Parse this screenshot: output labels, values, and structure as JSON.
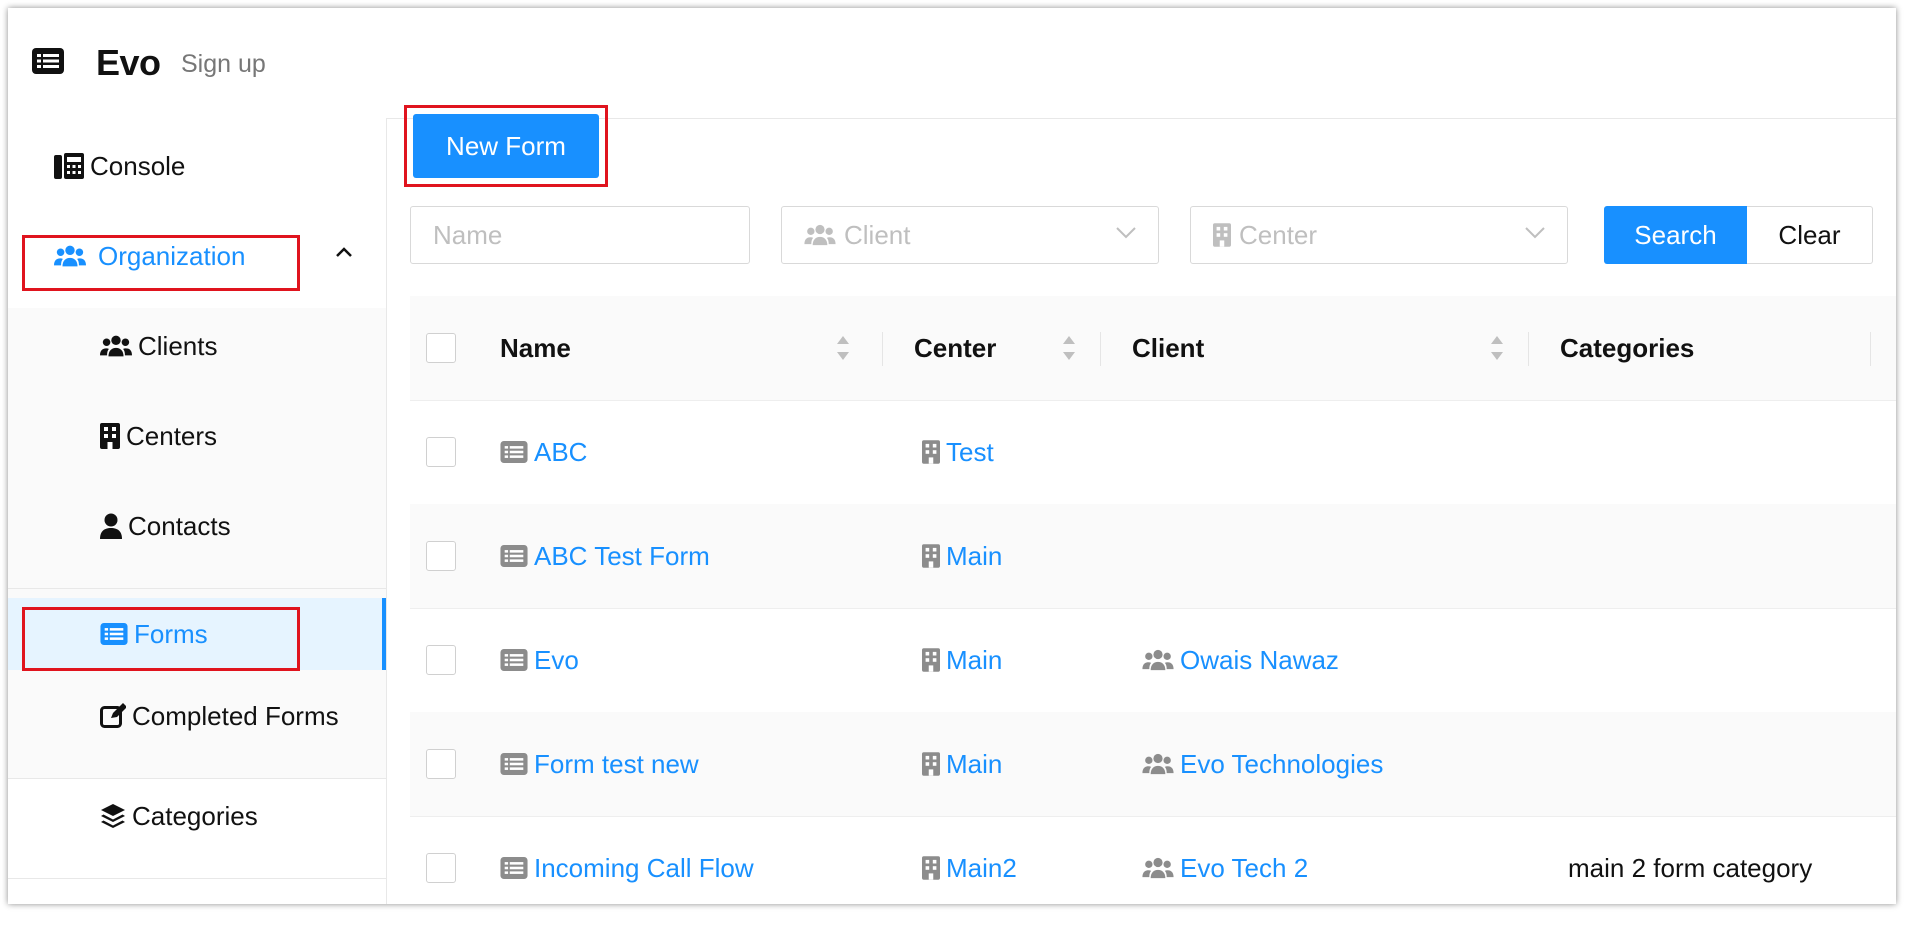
{
  "header": {
    "brand": "Evo",
    "signup": "Sign up"
  },
  "sidebar": {
    "console": "Console",
    "organization": "Organization",
    "sub": {
      "clients": "Clients",
      "centers": "Centers",
      "contacts": "Contacts",
      "forms": "Forms",
      "completed_forms": "Completed Forms"
    },
    "categories": "Categories"
  },
  "toolbar": {
    "new_form": "New Form"
  },
  "filters": {
    "name_placeholder": "Name",
    "client_placeholder": "Client",
    "center_placeholder": "Center",
    "search": "Search",
    "clear": "Clear"
  },
  "table": {
    "headers": {
      "name": "Name",
      "center": "Center",
      "client": "Client",
      "categories": "Categories"
    },
    "rows": [
      {
        "name": "ABC",
        "center": "Test",
        "client": "",
        "categories": ""
      },
      {
        "name": "ABC Test Form",
        "center": "Main",
        "client": "",
        "categories": ""
      },
      {
        "name": "Evo",
        "center": "Main",
        "client": "Owais Nawaz",
        "categories": ""
      },
      {
        "name": "Form test new",
        "center": "Main",
        "client": "Evo Technologies",
        "categories": ""
      },
      {
        "name": "Incoming Call Flow",
        "center": "Main2",
        "client": "Evo Tech 2",
        "categories": "main 2 form category"
      }
    ]
  },
  "colors": {
    "accent": "#1890ff",
    "highlight": "#e0141e"
  }
}
